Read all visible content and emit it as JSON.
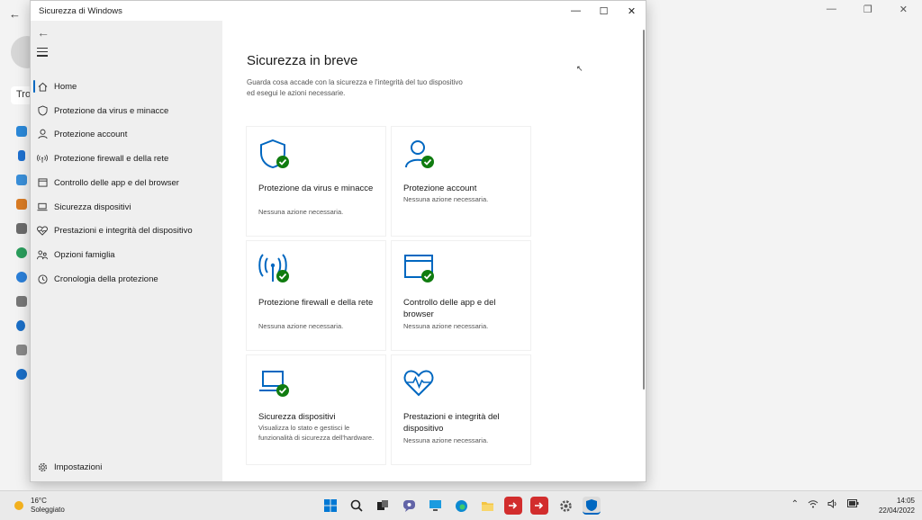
{
  "background": {
    "search_text": "Tro"
  },
  "window": {
    "title": "Sicurezza di Windows",
    "controls": {
      "minimize": "—",
      "maximize": "☐",
      "close": "✕"
    }
  },
  "sidebar": {
    "back": "←",
    "items": [
      {
        "label": "Home",
        "icon": "home-icon"
      },
      {
        "label": "Protezione da virus e minacce",
        "icon": "shield-icon"
      },
      {
        "label": "Protezione account",
        "icon": "person-icon"
      },
      {
        "label": "Protezione firewall e della rete",
        "icon": "wifi-antenna-icon"
      },
      {
        "label": "Controllo delle app e del browser",
        "icon": "browser-window-icon"
      },
      {
        "label": "Sicurezza dispositivi",
        "icon": "laptop-icon"
      },
      {
        "label": "Prestazioni e integrità del dispositivo",
        "icon": "heart-icon"
      },
      {
        "label": "Opzioni famiglia",
        "icon": "family-icon"
      },
      {
        "label": "Cronologia della protezione",
        "icon": "history-icon"
      }
    ],
    "settings_label": "Impostazioni"
  },
  "content": {
    "title": "Sicurezza in breve",
    "description": "Guarda cosa accade con la sicurezza e l'integrità del tuo dispositivo ed esegui le azioni necessarie.",
    "cards": [
      {
        "title": "Protezione da virus e minacce",
        "status": "Nessuna azione necessaria.",
        "icon": "shield-check-icon"
      },
      {
        "title": "Protezione account",
        "status": "Nessuna azione necessaria.",
        "icon": "person-check-icon"
      },
      {
        "title": "Protezione firewall e della rete",
        "status": "Nessuna azione necessaria.",
        "icon": "antenna-check-icon"
      },
      {
        "title": "Controllo delle app e del browser",
        "status": "Nessuna azione necessaria.",
        "icon": "browser-check-icon"
      },
      {
        "title": "Sicurezza dispositivi",
        "status": "Visualizza lo stato e gestisci le funzionalità di sicurezza dell'hardware.",
        "icon": "laptop-check-icon"
      },
      {
        "title": "Prestazioni e integrità del dispositivo",
        "status": "Nessuna azione necessaria.",
        "icon": "heart-pulse-icon"
      }
    ]
  },
  "colors": {
    "accent": "#0067c0",
    "check": "#107c10"
  },
  "taskbar": {
    "weather_temp": "16°C",
    "weather_desc": "Soleggiato",
    "time": "14:05",
    "date": "22/04/2022",
    "apps": [
      "start-icon",
      "search-icon",
      "task-view-icon",
      "teams-chat-icon",
      "monitor-icon",
      "edge-icon",
      "file-explorer-icon",
      "remote-app-icon",
      "remote-app-2-icon",
      "settings-icon",
      "windows-security-icon"
    ]
  }
}
